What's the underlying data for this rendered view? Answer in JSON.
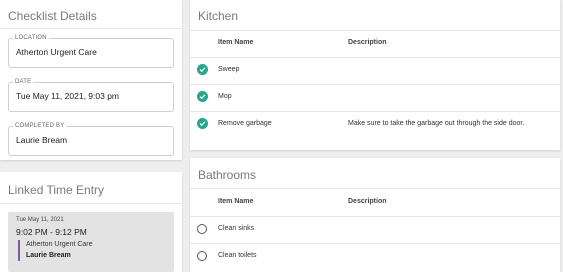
{
  "checklist_details": {
    "title": "Checklist Details",
    "location": {
      "label": "LOCATION",
      "value": "Atherton Urgent Care"
    },
    "date": {
      "label": "DATE",
      "value": "Tue May 11, 2021, 9:03 pm"
    },
    "completed_by": {
      "label": "COMPLETED BY",
      "value": "Laurie Bream"
    }
  },
  "linked_time_entry": {
    "title": "Linked Time Entry",
    "entry": {
      "date": "Tue May 11, 2021",
      "time_range": "9:02 PM - 9:12 PM",
      "location": "Atherton Urgent Care",
      "person": "Laurie Bream"
    },
    "accent_color": "#7b5ea7"
  },
  "kitchen": {
    "title": "Kitchen",
    "columns": {
      "name": "Item Name",
      "description": "Description"
    },
    "items": [
      {
        "name": "Sweep",
        "description": "",
        "status": "done"
      },
      {
        "name": "Mop",
        "description": "",
        "status": "done"
      },
      {
        "name": "Remove garbage",
        "description": "Make sure to take the garbage out through the side door.",
        "status": "done"
      }
    ]
  },
  "bathrooms": {
    "title": "Bathrooms",
    "columns": {
      "name": "Item Name",
      "description": "Description"
    },
    "items": [
      {
        "name": "Clean sinks",
        "description": "",
        "status": "pending"
      },
      {
        "name": "Clean toilets",
        "description": "",
        "status": "pending"
      }
    ]
  },
  "colors": {
    "check_done": "#26a68a",
    "page_background": "#eeeeee"
  },
  "icons": {
    "done": "check-circle-icon",
    "pending": "empty-circle-icon"
  }
}
